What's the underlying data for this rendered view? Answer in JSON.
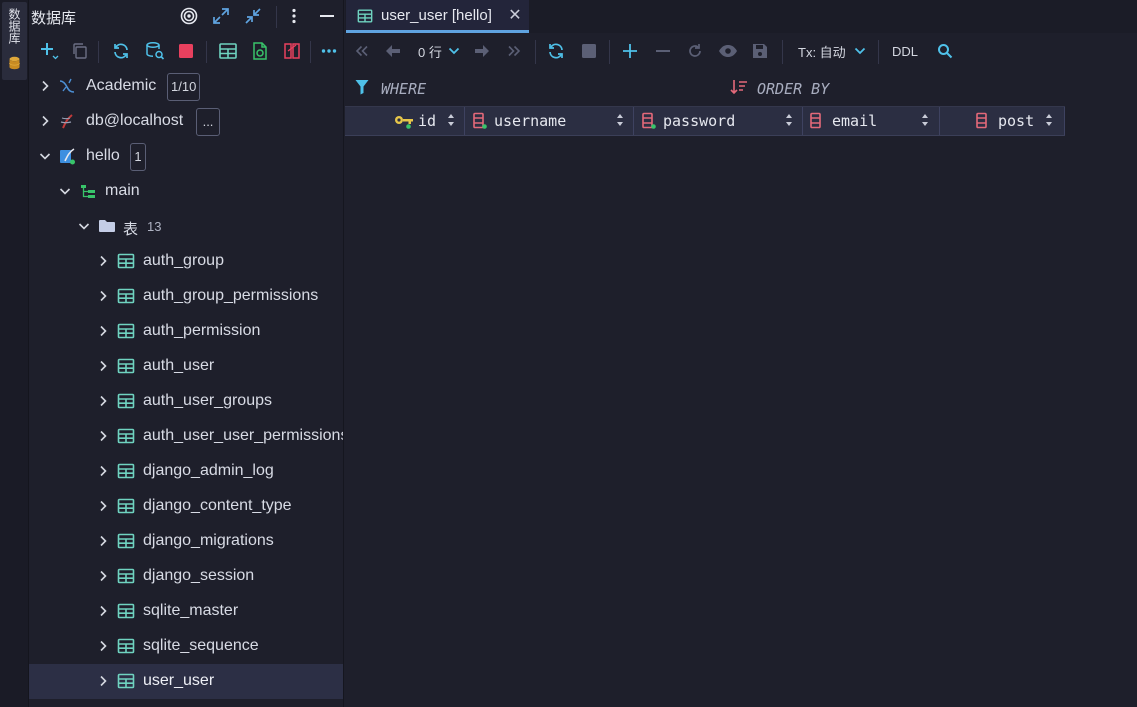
{
  "left_strip": {
    "label": "数据库",
    "icon": "database-icon"
  },
  "sidebar": {
    "title": "数据库",
    "header_icons": [
      "target-icon",
      "expand-icon",
      "collapse-icon",
      "more-vertical-icon",
      "minimize-icon"
    ],
    "toolbar_icons": [
      "add-icon",
      "copy-icon",
      "refresh-icon",
      "query-icon",
      "stop-icon",
      "table-icon",
      "export-icon",
      "compare-icon",
      "more-horizontal-icon"
    ],
    "tree": [
      {
        "label": "Academic",
        "badge": "1/10",
        "icon": "mysql-icon",
        "expanded": false,
        "level": 0
      },
      {
        "label": "db@localhost",
        "badge": "...",
        "icon": "mssql-icon",
        "expanded": false,
        "level": 0
      },
      {
        "label": "hello",
        "badge": "1",
        "icon": "sqlite-icon",
        "expanded": true,
        "level": 0
      },
      {
        "label": "main",
        "icon": "schema-icon",
        "expanded": true,
        "level": 1
      },
      {
        "label": "表",
        "count": "13",
        "icon": "folder-icon",
        "expanded": true,
        "level": 2
      },
      {
        "label": "auth_group",
        "icon": "table-icon",
        "level": 3
      },
      {
        "label": "auth_group_permissions",
        "icon": "table-icon",
        "level": 3
      },
      {
        "label": "auth_permission",
        "icon": "table-icon",
        "level": 3
      },
      {
        "label": "auth_user",
        "icon": "table-icon",
        "level": 3
      },
      {
        "label": "auth_user_groups",
        "icon": "table-icon",
        "level": 3
      },
      {
        "label": "auth_user_user_permissions",
        "icon": "table-icon",
        "level": 3
      },
      {
        "label": "django_admin_log",
        "icon": "table-icon",
        "level": 3
      },
      {
        "label": "django_content_type",
        "icon": "table-icon",
        "level": 3
      },
      {
        "label": "django_migrations",
        "icon": "table-icon",
        "level": 3
      },
      {
        "label": "django_session",
        "icon": "table-icon",
        "level": 3
      },
      {
        "label": "sqlite_master",
        "icon": "table-icon",
        "level": 3
      },
      {
        "label": "sqlite_sequence",
        "icon": "table-icon",
        "level": 3
      },
      {
        "label": "user_user",
        "icon": "table-icon",
        "level": 3,
        "selected": true
      }
    ]
  },
  "editor": {
    "tab": {
      "label": "user_user [hello]",
      "close": "✕"
    },
    "toolbar": {
      "rows_label": "0 行",
      "tx_label": "Tx: 自动",
      "ddl_label": "DDL"
    },
    "filter": {
      "where_label": "WHERE",
      "order_label": "ORDER BY"
    },
    "columns": [
      {
        "name": "id",
        "icon": "primary-key-icon"
      },
      {
        "name": "username",
        "icon": "column-icon"
      },
      {
        "name": "password",
        "icon": "column-icon"
      },
      {
        "name": "email",
        "icon": "column-icon"
      },
      {
        "name": "post",
        "icon": "column-icon"
      }
    ]
  },
  "colors": {
    "background": "#1e1f2b",
    "accent": "#5fa3e0",
    "table_icon": "#6fd3c0",
    "column_icon": "#e4697a",
    "key_icon": "#e7c64a"
  }
}
